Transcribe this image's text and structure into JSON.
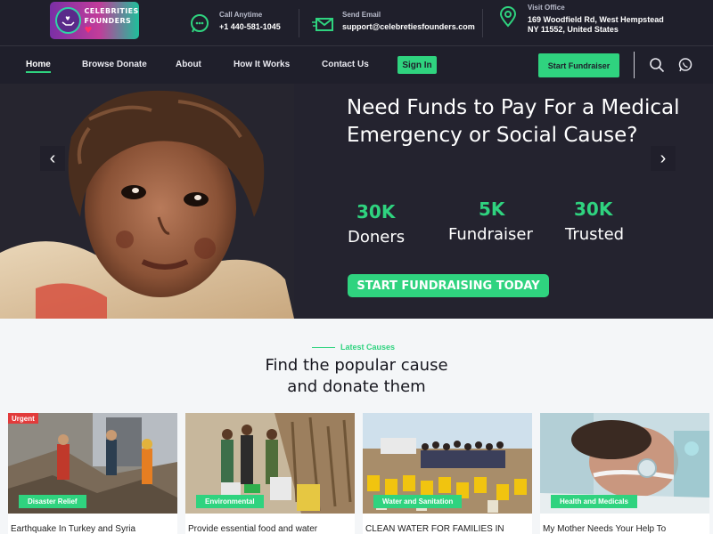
{
  "brand": {
    "logo_line1": "CELEBRITIES",
    "logo_line2": "FOUNDERS"
  },
  "contacts": [
    {
      "label": "Call Anytime",
      "value": "+1 440-581-1045",
      "icon": "whatsapp-chat-icon"
    },
    {
      "label": "Send Email",
      "value": "support@celebretiesfounders.com",
      "icon": "envelope-icon"
    },
    {
      "label": "Visit Office",
      "value_line1": "169 Woodfield Rd, West Hempstead",
      "value_line2": "NY 11552, United States",
      "icon": "location-pin-icon"
    }
  ],
  "nav": {
    "items": [
      {
        "label": "Home",
        "active": true
      },
      {
        "label": "Browse Donate"
      },
      {
        "label": "About"
      },
      {
        "label": "How It Works"
      },
      {
        "label": "Contact Us"
      }
    ],
    "sign_in": "Sign In",
    "start_fundraiser": "Start Fundraiser",
    "icons": [
      "search-icon",
      "whatsapp-icon"
    ]
  },
  "hero": {
    "title": "Need Funds to Pay For a Medical Emergency or Social Cause?",
    "stats": [
      {
        "value": "30K",
        "label": "Doners"
      },
      {
        "value": "5K",
        "label": "Fundraiser"
      },
      {
        "value": "30K",
        "label": "Trusted"
      }
    ],
    "cta": "START FUNDRAISING TODAY"
  },
  "causes": {
    "kicker": "Latest Causes",
    "title_line1": "Find the popular cause",
    "title_line2": "and donate them",
    "cards": [
      {
        "tag": "Disaster Relief",
        "title": "Earthquake In Turkey and Syria",
        "urgent": "Urgent"
      },
      {
        "tag": "Environmental",
        "title": "Provide essential food and water"
      },
      {
        "tag": "Water and Sanitation",
        "title": "CLEAN WATER FOR FAMILIES IN"
      },
      {
        "tag": "Health and Medicals",
        "title": "My Mother Needs Your Help To"
      }
    ]
  },
  "colors": {
    "accent": "#2fd37f",
    "dark": "#1f1f2b",
    "urgent": "#e23b3b"
  }
}
